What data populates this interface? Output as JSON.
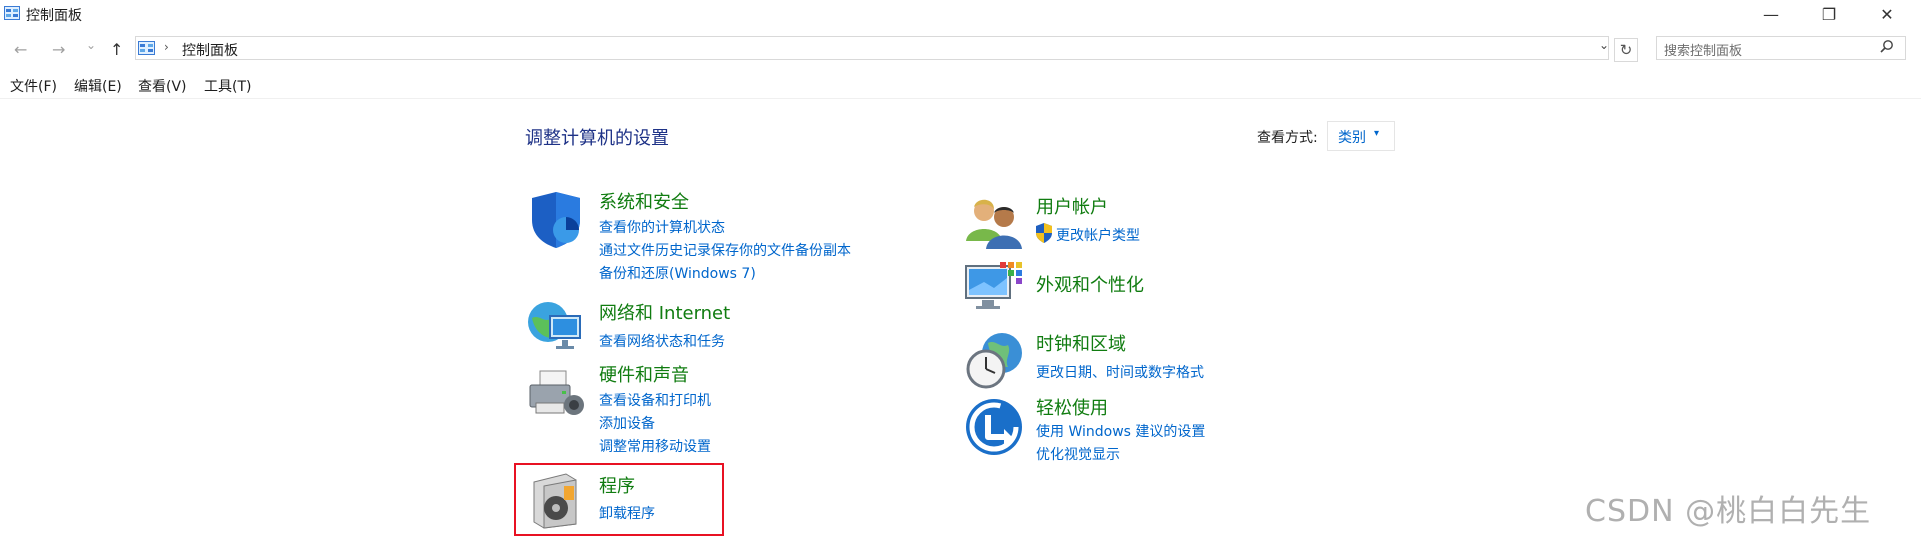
{
  "window": {
    "title": "控制面板",
    "minimize": "—",
    "restore": "❐",
    "close": "✕"
  },
  "address_bar": {
    "back": "←",
    "forward": "→",
    "recent": "⌄",
    "up": "↑",
    "separator": "›",
    "path": "控制面板",
    "dropdown": "⌄",
    "refresh": "↻"
  },
  "search": {
    "placeholder": "搜索控制面板",
    "icon": "search-icon"
  },
  "menu": [
    "文件(F)",
    "编辑(E)",
    "查看(V)",
    "工具(T)"
  ],
  "content": {
    "heading": "调整计算机的设置",
    "view_by_label": "查看方式:",
    "view_by_value": "类别",
    "view_caret": "▾"
  },
  "categories_left": [
    {
      "icon": "shield-icon",
      "title": "系统和安全",
      "links": [
        "查看你的计算机状态",
        "通过文件历史记录保存你的文件备份副本",
        "备份和还原(Windows 7)"
      ]
    },
    {
      "icon": "network-globe-icon",
      "title": "网络和 Internet",
      "links": [
        "查看网络状态和任务"
      ]
    },
    {
      "icon": "printer-icon",
      "title": "硬件和声音",
      "links": [
        "查看设备和打印机",
        "添加设备",
        "调整常用移动设置"
      ]
    },
    {
      "icon": "programs-disc-icon",
      "title": "程序",
      "links": [
        "卸载程序"
      ]
    }
  ],
  "categories_right": [
    {
      "icon": "users-icon",
      "title": "用户帐户",
      "links": [
        "更改帐户类型"
      ]
    },
    {
      "icon": "display-color-icon",
      "title": "外观和个性化",
      "links": []
    },
    {
      "icon": "clock-globe-icon",
      "title": "时钟和区域",
      "links": [
        "更改日期、时间或数字格式"
      ]
    },
    {
      "icon": "ease-of-access-icon",
      "title": "轻松使用",
      "links": [
        "使用 Windows 建议的设置",
        "优化视觉显示"
      ]
    }
  ],
  "colors": {
    "heading": "#1e3287",
    "category_title": "#107c10",
    "link": "#0066cc",
    "highlight_box": "#e81123"
  },
  "watermark": "CSDN @桃白白先生"
}
